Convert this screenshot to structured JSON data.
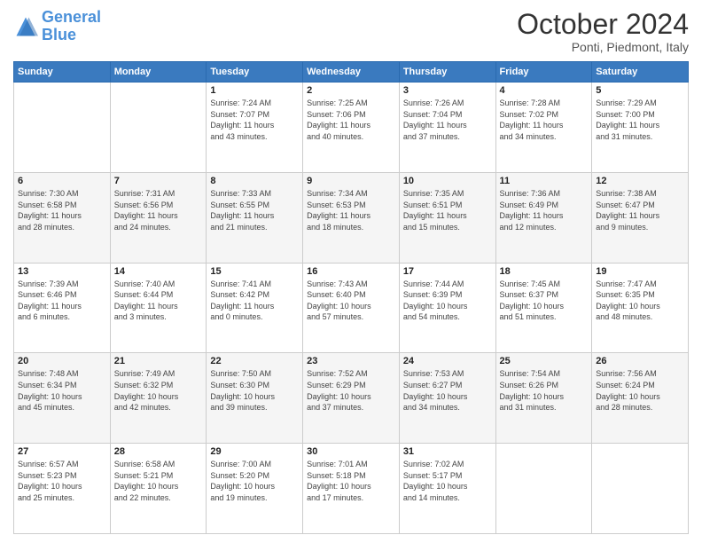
{
  "logo": {
    "line1": "General",
    "line2": "Blue"
  },
  "header": {
    "month": "October 2024",
    "location": "Ponti, Piedmont, Italy"
  },
  "weekdays": [
    "Sunday",
    "Monday",
    "Tuesday",
    "Wednesday",
    "Thursday",
    "Friday",
    "Saturday"
  ],
  "weeks": [
    [
      {
        "day": "",
        "info": ""
      },
      {
        "day": "",
        "info": ""
      },
      {
        "day": "1",
        "info": "Sunrise: 7:24 AM\nSunset: 7:07 PM\nDaylight: 11 hours\nand 43 minutes."
      },
      {
        "day": "2",
        "info": "Sunrise: 7:25 AM\nSunset: 7:06 PM\nDaylight: 11 hours\nand 40 minutes."
      },
      {
        "day": "3",
        "info": "Sunrise: 7:26 AM\nSunset: 7:04 PM\nDaylight: 11 hours\nand 37 minutes."
      },
      {
        "day": "4",
        "info": "Sunrise: 7:28 AM\nSunset: 7:02 PM\nDaylight: 11 hours\nand 34 minutes."
      },
      {
        "day": "5",
        "info": "Sunrise: 7:29 AM\nSunset: 7:00 PM\nDaylight: 11 hours\nand 31 minutes."
      }
    ],
    [
      {
        "day": "6",
        "info": "Sunrise: 7:30 AM\nSunset: 6:58 PM\nDaylight: 11 hours\nand 28 minutes."
      },
      {
        "day": "7",
        "info": "Sunrise: 7:31 AM\nSunset: 6:56 PM\nDaylight: 11 hours\nand 24 minutes."
      },
      {
        "day": "8",
        "info": "Sunrise: 7:33 AM\nSunset: 6:55 PM\nDaylight: 11 hours\nand 21 minutes."
      },
      {
        "day": "9",
        "info": "Sunrise: 7:34 AM\nSunset: 6:53 PM\nDaylight: 11 hours\nand 18 minutes."
      },
      {
        "day": "10",
        "info": "Sunrise: 7:35 AM\nSunset: 6:51 PM\nDaylight: 11 hours\nand 15 minutes."
      },
      {
        "day": "11",
        "info": "Sunrise: 7:36 AM\nSunset: 6:49 PM\nDaylight: 11 hours\nand 12 minutes."
      },
      {
        "day": "12",
        "info": "Sunrise: 7:38 AM\nSunset: 6:47 PM\nDaylight: 11 hours\nand 9 minutes."
      }
    ],
    [
      {
        "day": "13",
        "info": "Sunrise: 7:39 AM\nSunset: 6:46 PM\nDaylight: 11 hours\nand 6 minutes."
      },
      {
        "day": "14",
        "info": "Sunrise: 7:40 AM\nSunset: 6:44 PM\nDaylight: 11 hours\nand 3 minutes."
      },
      {
        "day": "15",
        "info": "Sunrise: 7:41 AM\nSunset: 6:42 PM\nDaylight: 11 hours\nand 0 minutes."
      },
      {
        "day": "16",
        "info": "Sunrise: 7:43 AM\nSunset: 6:40 PM\nDaylight: 10 hours\nand 57 minutes."
      },
      {
        "day": "17",
        "info": "Sunrise: 7:44 AM\nSunset: 6:39 PM\nDaylight: 10 hours\nand 54 minutes."
      },
      {
        "day": "18",
        "info": "Sunrise: 7:45 AM\nSunset: 6:37 PM\nDaylight: 10 hours\nand 51 minutes."
      },
      {
        "day": "19",
        "info": "Sunrise: 7:47 AM\nSunset: 6:35 PM\nDaylight: 10 hours\nand 48 minutes."
      }
    ],
    [
      {
        "day": "20",
        "info": "Sunrise: 7:48 AM\nSunset: 6:34 PM\nDaylight: 10 hours\nand 45 minutes."
      },
      {
        "day": "21",
        "info": "Sunrise: 7:49 AM\nSunset: 6:32 PM\nDaylight: 10 hours\nand 42 minutes."
      },
      {
        "day": "22",
        "info": "Sunrise: 7:50 AM\nSunset: 6:30 PM\nDaylight: 10 hours\nand 39 minutes."
      },
      {
        "day": "23",
        "info": "Sunrise: 7:52 AM\nSunset: 6:29 PM\nDaylight: 10 hours\nand 37 minutes."
      },
      {
        "day": "24",
        "info": "Sunrise: 7:53 AM\nSunset: 6:27 PM\nDaylight: 10 hours\nand 34 minutes."
      },
      {
        "day": "25",
        "info": "Sunrise: 7:54 AM\nSunset: 6:26 PM\nDaylight: 10 hours\nand 31 minutes."
      },
      {
        "day": "26",
        "info": "Sunrise: 7:56 AM\nSunset: 6:24 PM\nDaylight: 10 hours\nand 28 minutes."
      }
    ],
    [
      {
        "day": "27",
        "info": "Sunrise: 6:57 AM\nSunset: 5:23 PM\nDaylight: 10 hours\nand 25 minutes."
      },
      {
        "day": "28",
        "info": "Sunrise: 6:58 AM\nSunset: 5:21 PM\nDaylight: 10 hours\nand 22 minutes."
      },
      {
        "day": "29",
        "info": "Sunrise: 7:00 AM\nSunset: 5:20 PM\nDaylight: 10 hours\nand 19 minutes."
      },
      {
        "day": "30",
        "info": "Sunrise: 7:01 AM\nSunset: 5:18 PM\nDaylight: 10 hours\nand 17 minutes."
      },
      {
        "day": "31",
        "info": "Sunrise: 7:02 AM\nSunset: 5:17 PM\nDaylight: 10 hours\nand 14 minutes."
      },
      {
        "day": "",
        "info": ""
      },
      {
        "day": "",
        "info": ""
      }
    ]
  ]
}
